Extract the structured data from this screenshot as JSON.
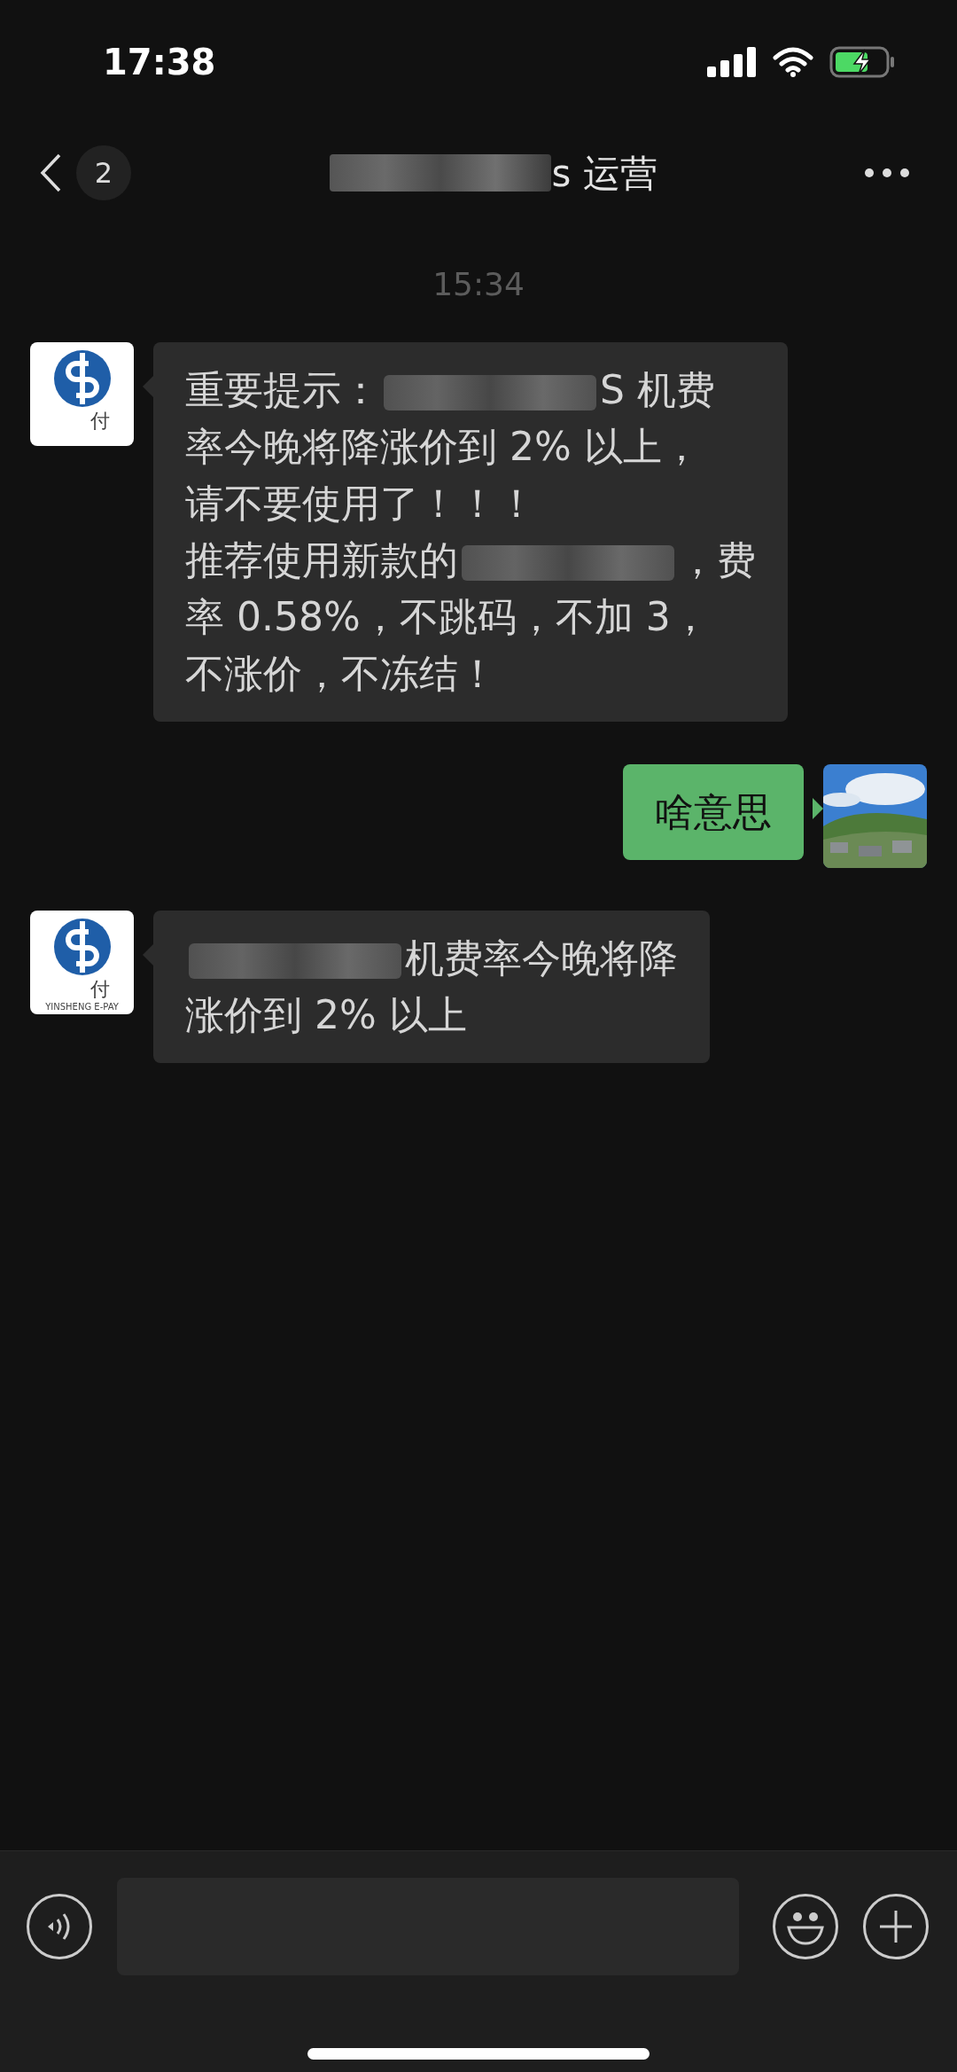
{
  "status_bar": {
    "time": "17:38"
  },
  "header": {
    "back_count": "2",
    "title": [
      {
        "kind": "blur"
      },
      {
        "kind": "text",
        "text": "s 运营"
      }
    ]
  },
  "timestamp": "15:34",
  "messages": [
    {
      "kind": "received",
      "avatar": {
        "kind": "logo",
        "char": "付"
      },
      "lines": [
        [
          {
            "kind": "text",
            "text": "重要提示："
          },
          {
            "kind": "blur"
          },
          {
            "kind": "text",
            "text": "S 机费"
          }
        ],
        [
          {
            "kind": "text",
            "text": "率今晚将降涨价到 2% 以上，"
          }
        ],
        [
          {
            "kind": "text",
            "text": "请不要使用了！！！"
          }
        ],
        [
          {
            "kind": "text",
            "text": "推荐使用新款的"
          },
          {
            "kind": "blur"
          },
          {
            "kind": "text",
            "text": "，费"
          }
        ],
        [
          {
            "kind": "text",
            "text": "率 0.58%，不跳码，不加 3，"
          }
        ],
        [
          {
            "kind": "text",
            "text": "不涨价，不冻结！"
          }
        ]
      ]
    },
    {
      "kind": "sent",
      "avatar": {
        "kind": "picture"
      },
      "lines": [
        [
          {
            "kind": "text",
            "text": "啥意思"
          }
        ]
      ]
    },
    {
      "kind": "received",
      "avatar": {
        "kind": "logo",
        "char": "付",
        "latin": "YINSHENG E-PAY"
      },
      "lines": [
        [
          {
            "kind": "blur"
          },
          {
            "kind": "text",
            "text": "机费率今晚将降"
          }
        ],
        [
          {
            "kind": "text",
            "text": "涨价到 2% 以上"
          }
        ]
      ]
    }
  ]
}
